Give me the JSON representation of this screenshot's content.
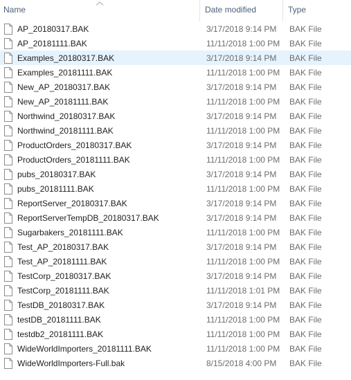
{
  "columns": {
    "name": "Name",
    "date_modified": "Date modified",
    "type": "Type"
  },
  "sort": {
    "column": "name",
    "direction": "ascending",
    "icon": "sort-up-chevron-icon"
  },
  "hovered_row": 2,
  "files": [
    {
      "name": "AP_20180317.BAK",
      "date": "3/17/2018 9:14 PM",
      "type": "BAK File"
    },
    {
      "name": "AP_20181111.BAK",
      "date": "11/11/2018 1:00 PM",
      "type": "BAK File"
    },
    {
      "name": "Examples_20180317.BAK",
      "date": "3/17/2018 9:14 PM",
      "type": "BAK File"
    },
    {
      "name": "Examples_20181111.BAK",
      "date": "11/11/2018 1:00 PM",
      "type": "BAK File"
    },
    {
      "name": "New_AP_20180317.BAK",
      "date": "3/17/2018 9:14 PM",
      "type": "BAK File"
    },
    {
      "name": "New_AP_20181111.BAK",
      "date": "11/11/2018 1:00 PM",
      "type": "BAK File"
    },
    {
      "name": "Northwind_20180317.BAK",
      "date": "3/17/2018 9:14 PM",
      "type": "BAK File"
    },
    {
      "name": "Northwind_20181111.BAK",
      "date": "11/11/2018 1:00 PM",
      "type": "BAK File"
    },
    {
      "name": "ProductOrders_20180317.BAK",
      "date": "3/17/2018 9:14 PM",
      "type": "BAK File"
    },
    {
      "name": "ProductOrders_20181111.BAK",
      "date": "11/11/2018 1:00 PM",
      "type": "BAK File"
    },
    {
      "name": "pubs_20180317.BAK",
      "date": "3/17/2018 9:14 PM",
      "type": "BAK File"
    },
    {
      "name": "pubs_20181111.BAK",
      "date": "11/11/2018 1:00 PM",
      "type": "BAK File"
    },
    {
      "name": "ReportServer_20180317.BAK",
      "date": "3/17/2018 9:14 PM",
      "type": "BAK File"
    },
    {
      "name": "ReportServerTempDB_20180317.BAK",
      "date": "3/17/2018 9:14 PM",
      "type": "BAK File"
    },
    {
      "name": "Sugarbakers_20181111.BAK",
      "date": "11/11/2018 1:00 PM",
      "type": "BAK File"
    },
    {
      "name": "Test_AP_20180317.BAK",
      "date": "3/17/2018 9:14 PM",
      "type": "BAK File"
    },
    {
      "name": "Test_AP_20181111.BAK",
      "date": "11/11/2018 1:00 PM",
      "type": "BAK File"
    },
    {
      "name": "TestCorp_20180317.BAK",
      "date": "3/17/2018 9:14 PM",
      "type": "BAK File"
    },
    {
      "name": "TestCorp_20181111.BAK",
      "date": "11/11/2018 1:01 PM",
      "type": "BAK File"
    },
    {
      "name": "TestDB_20180317.BAK",
      "date": "3/17/2018 9:14 PM",
      "type": "BAK File"
    },
    {
      "name": "testDB_20181111.BAK",
      "date": "11/11/2018 1:00 PM",
      "type": "BAK File"
    },
    {
      "name": "testdb2_20181111.BAK",
      "date": "11/11/2018 1:00 PM",
      "type": "BAK File"
    },
    {
      "name": "WideWorldImporters_20181111.BAK",
      "date": "11/11/2018 1:00 PM",
      "type": "BAK File"
    },
    {
      "name": "WideWorldImporters-Full.bak",
      "date": "8/15/2018 4:00 PM",
      "type": "BAK File"
    }
  ]
}
